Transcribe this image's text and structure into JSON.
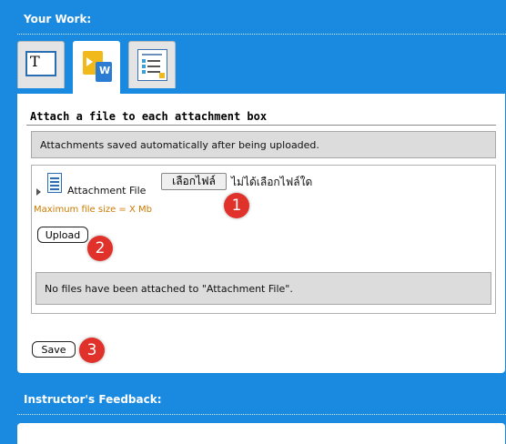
{
  "your_work": {
    "title": "Your Work:"
  },
  "tabs": [
    {
      "name": "text-entry",
      "icon": "text-box-icon",
      "glyph": "T"
    },
    {
      "name": "file-attach",
      "icon": "attachment-doc-icon",
      "glyph": "W"
    },
    {
      "name": "outline",
      "icon": "outline-doc-icon",
      "glyph": ""
    }
  ],
  "attachments": {
    "heading": "Attach a file to each attachment box",
    "saved_note": "Attachments saved automatically after being uploaded.",
    "field_label": "Attachment File",
    "choose_file_label": "เลือกไฟล์",
    "no_file_chosen": "ไม่ได้เลือกไฟล์ใด",
    "max_size_note": "Maximum file size = X Mb",
    "upload_label": "Upload",
    "none_attached": "No files have been attached to \"Attachment File\"."
  },
  "save_label": "Save",
  "feedback": {
    "title": "Instructor's Feedback:"
  },
  "badges": [
    "1",
    "2",
    "3"
  ],
  "colors": {
    "background": "#1a8ae0",
    "badge": "#e0312b",
    "max_size_text": "#cc7a00",
    "info_box": "#dcdcdc"
  }
}
